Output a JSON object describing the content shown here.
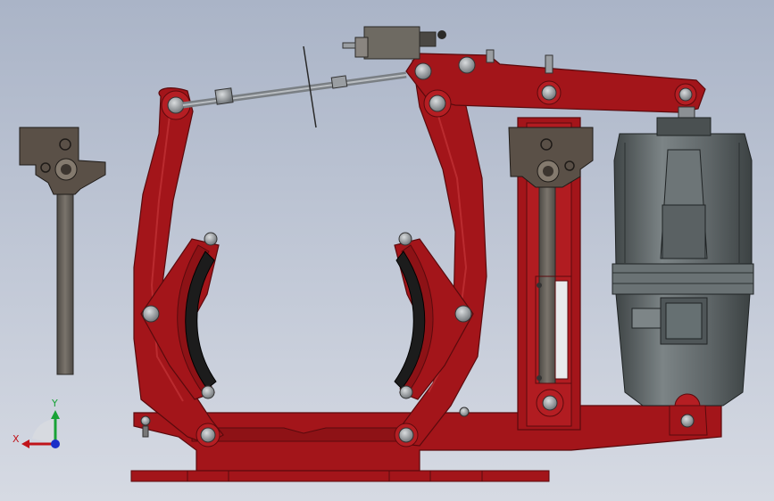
{
  "colors": {
    "background_top": "#aab4c7",
    "background_bottom": "#d6dae3",
    "frame_red": "#a3151a",
    "frame_red_dark": "#6e0c10",
    "bolt_gray": "#8a8f94",
    "rod_gray": "#6f6a62",
    "motor_gray": "#5d6466",
    "pad_black": "#1c1c1c",
    "axis_x": "#c0141a",
    "axis_y": "#18a236",
    "axis_z": "#1b2fc8"
  },
  "triad": {
    "x_label": "X",
    "y_label": "Y"
  }
}
